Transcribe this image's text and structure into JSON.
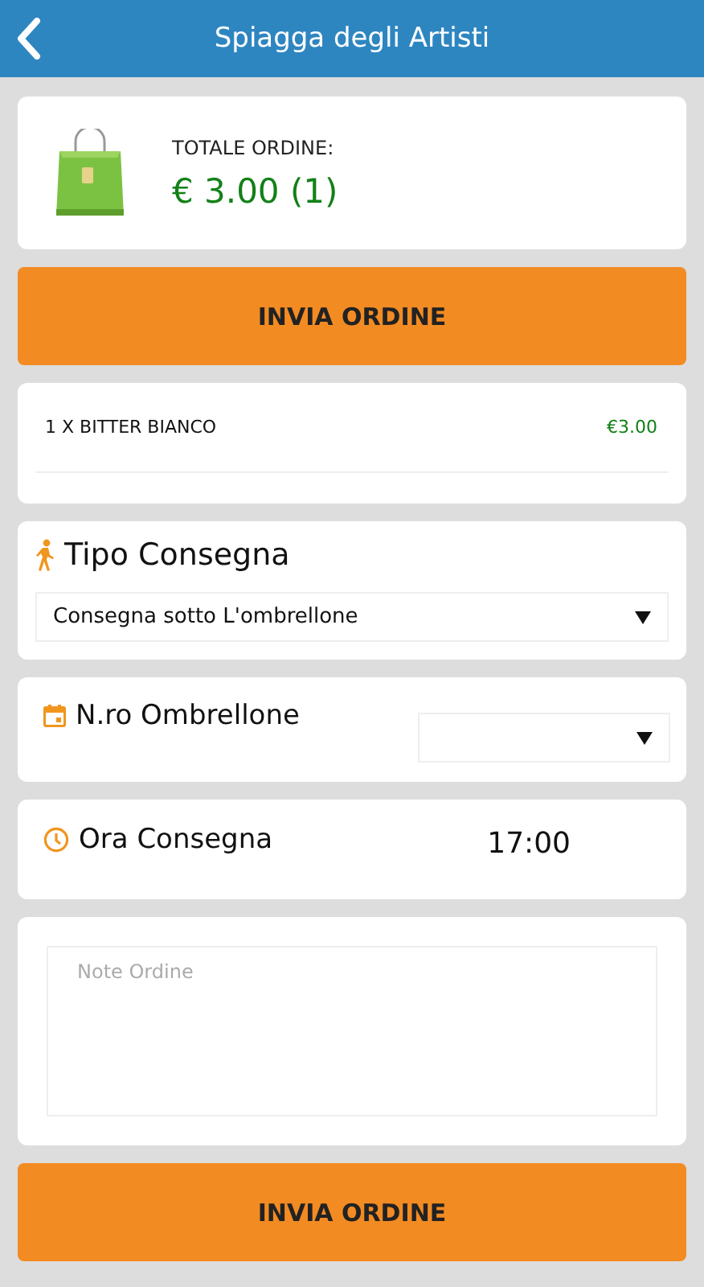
{
  "header": {
    "title": "Spiagga degli Artisti"
  },
  "total": {
    "label": "TOTALE ORDINE:",
    "value": "€ 3.00 (1)"
  },
  "submit_buttons": [
    "INVIA ORDINE",
    "INVIA ORDINE"
  ],
  "items": [
    {
      "name": "1 X BITTER BIANCO",
      "price": "€3.00"
    }
  ],
  "delivery_type": {
    "label": "Tipo Consegna",
    "value": "Consegna sotto L'ombrellone"
  },
  "umbrella_number": {
    "label": "N.ro Ombrellone"
  },
  "delivery_time": {
    "label": "Ora Consegna",
    "value": "17:00"
  },
  "notes": {
    "placeholder": "Note Ordine"
  }
}
